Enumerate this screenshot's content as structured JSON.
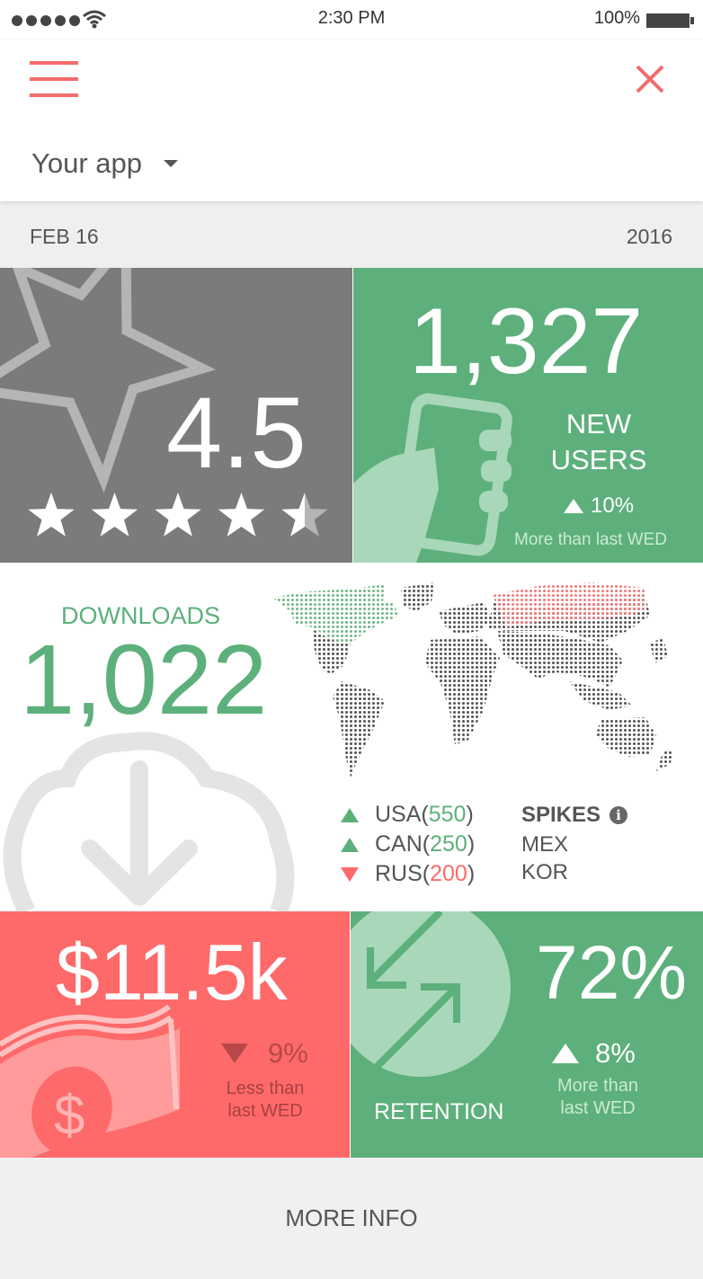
{
  "status_bar": {
    "time": "2:30 PM",
    "battery": "100%"
  },
  "header": {
    "app_selector": "Your app"
  },
  "date_bar": {
    "date": "FEB 16",
    "year": "2016"
  },
  "rating": {
    "value": "4.5",
    "stars": 4.5,
    "max_stars": 5
  },
  "new_users": {
    "value": "1,327",
    "label_line1": "NEW",
    "label_line2": "USERS",
    "change": "10%",
    "comparison": "More than last WED"
  },
  "downloads": {
    "label": "DOWNLOADS",
    "value": "1,022",
    "countries": [
      {
        "code": "USA",
        "open": " (",
        "count": "550",
        "close": ")",
        "trend": "up"
      },
      {
        "code": "CAN",
        "open": " (",
        "count": "250",
        "close": ")",
        "trend": "up"
      },
      {
        "code": "RUS",
        "open": " (",
        "count": "200",
        "close": ")",
        "trend": "down"
      }
    ],
    "spikes_title": "SPIKES",
    "spikes": [
      "MEX",
      "KOR"
    ]
  },
  "revenue": {
    "value": "$11.5k",
    "change": "9%",
    "comparison_line1": "Less than",
    "comparison_line2": "last WED"
  },
  "retention": {
    "value": "72%",
    "label": "RETENTION",
    "change": "8%",
    "comparison_line1": "More than",
    "comparison_line2": "last WED"
  },
  "footer": {
    "more_info": "MORE INFO"
  },
  "colors": {
    "green": "#5db07b",
    "red": "#fe6a6a",
    "gray": "#7b7b7b",
    "menu_accent": "#f26b6b"
  }
}
